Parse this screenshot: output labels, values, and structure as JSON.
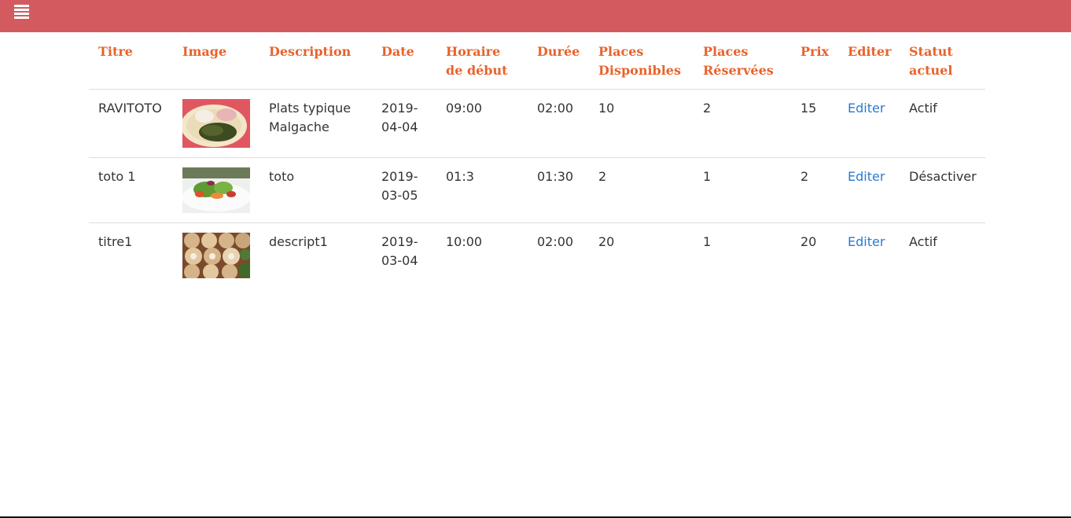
{
  "columns": [
    "Titre",
    "Image",
    "Description",
    "Date",
    "Horaire de début",
    "Durée",
    "Places Disponibles",
    "Places Réservées",
    "Prix",
    "Editer",
    "Statut actuel"
  ],
  "rows": [
    {
      "titre": "RAVITOTO",
      "image": "malagasy-dish-photo",
      "description": "Plats typique Malgache",
      "date": "2019-04-04",
      "horaire": "09:00",
      "duree": "02:00",
      "places_disponibles": "10",
      "places_reservees": "2",
      "prix": "15",
      "editer": "Editer",
      "statut": "Actif"
    },
    {
      "titre": "toto 1",
      "image": "salad-plate-photo",
      "description": "toto",
      "date": "2019-03-05",
      "horaire": "01:3",
      "duree": "01:30",
      "places_disponibles": "2",
      "places_reservees": "1",
      "prix": "2",
      "editer": "Editer",
      "statut": "Désactiver"
    },
    {
      "titre": "titre1",
      "image": "dim-sum-baskets-photo",
      "description": "descript1",
      "date": "2019-03-04",
      "horaire": "10:00",
      "duree": "02:00",
      "places_disponibles": "20",
      "places_reservees": "1",
      "prix": "20",
      "editer": "Editer",
      "statut": "Actif"
    }
  ],
  "colors": {
    "topbar": "#d35b5f",
    "header_text": "#e8632b",
    "link": "#2a7ad1"
  }
}
